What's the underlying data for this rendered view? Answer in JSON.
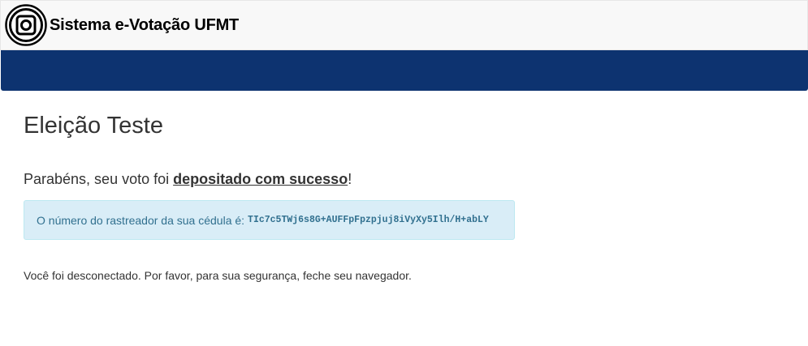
{
  "header": {
    "title": "Sistema e-Votação UFMT",
    "logo_icon": "concentric-square-logo-icon"
  },
  "navbar": {
    "color": "#0d3370"
  },
  "main": {
    "election_title": "Eleição Teste",
    "success_prefix": "Parabéns, seu voto foi ",
    "success_link": "depositado com sucesso",
    "success_suffix": "!",
    "tracker_label": "O número do rastreador da sua cédula é:",
    "tracker_code": "TIc7c5TWj6s8G+AUFFpFpzpjuj8iVyXy5Ilh/H+abLY",
    "logout_message": "Você foi desconectado. Por favor, para sua segurança, feche seu navegador."
  }
}
